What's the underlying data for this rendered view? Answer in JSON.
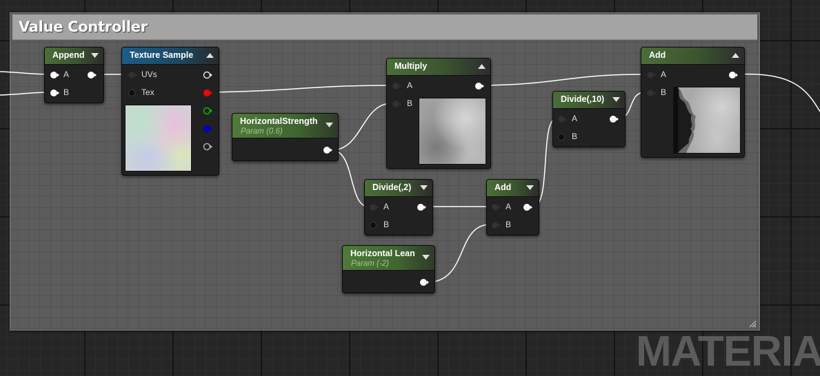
{
  "comment": {
    "title": "Value Controller"
  },
  "watermark": "MATERIAL",
  "nodes": {
    "append": {
      "title": "Append",
      "pins": {
        "a": "A",
        "b": "B"
      }
    },
    "texture_sample": {
      "title": "Texture Sample",
      "pins": {
        "uvs": "UVs",
        "tex": "Tex"
      }
    },
    "horizontal_strength": {
      "title": "HorizontalStrength",
      "subtitle": "Param (0.6)"
    },
    "multiply": {
      "title": "Multiply",
      "pins": {
        "a": "A",
        "b": "B"
      }
    },
    "divide_2": {
      "title": "Divide(,2)",
      "pins": {
        "a": "A",
        "b": "B"
      }
    },
    "add_small": {
      "title": "Add",
      "pins": {
        "a": "A",
        "b": "B"
      }
    },
    "horizontal_lean": {
      "title": "Horizontal Lean",
      "subtitle": "Param (-2)"
    },
    "divide_10": {
      "title": "Divide(,10)",
      "pins": {
        "a": "A",
        "b": "B"
      }
    },
    "add_final": {
      "title": "Add",
      "pins": {
        "a": "A",
        "b": "B"
      }
    }
  },
  "colors": {
    "graph_background": "#262626",
    "comment_body": "#5c5c5c",
    "comment_header": "#a4a4a4",
    "header_green": "#4a6e38",
    "header_blue": "#1c5d86",
    "wire": "#ffffff",
    "pin_red": "#ff0000",
    "pin_green": "#00c000",
    "pin_blue": "#0000d0"
  }
}
